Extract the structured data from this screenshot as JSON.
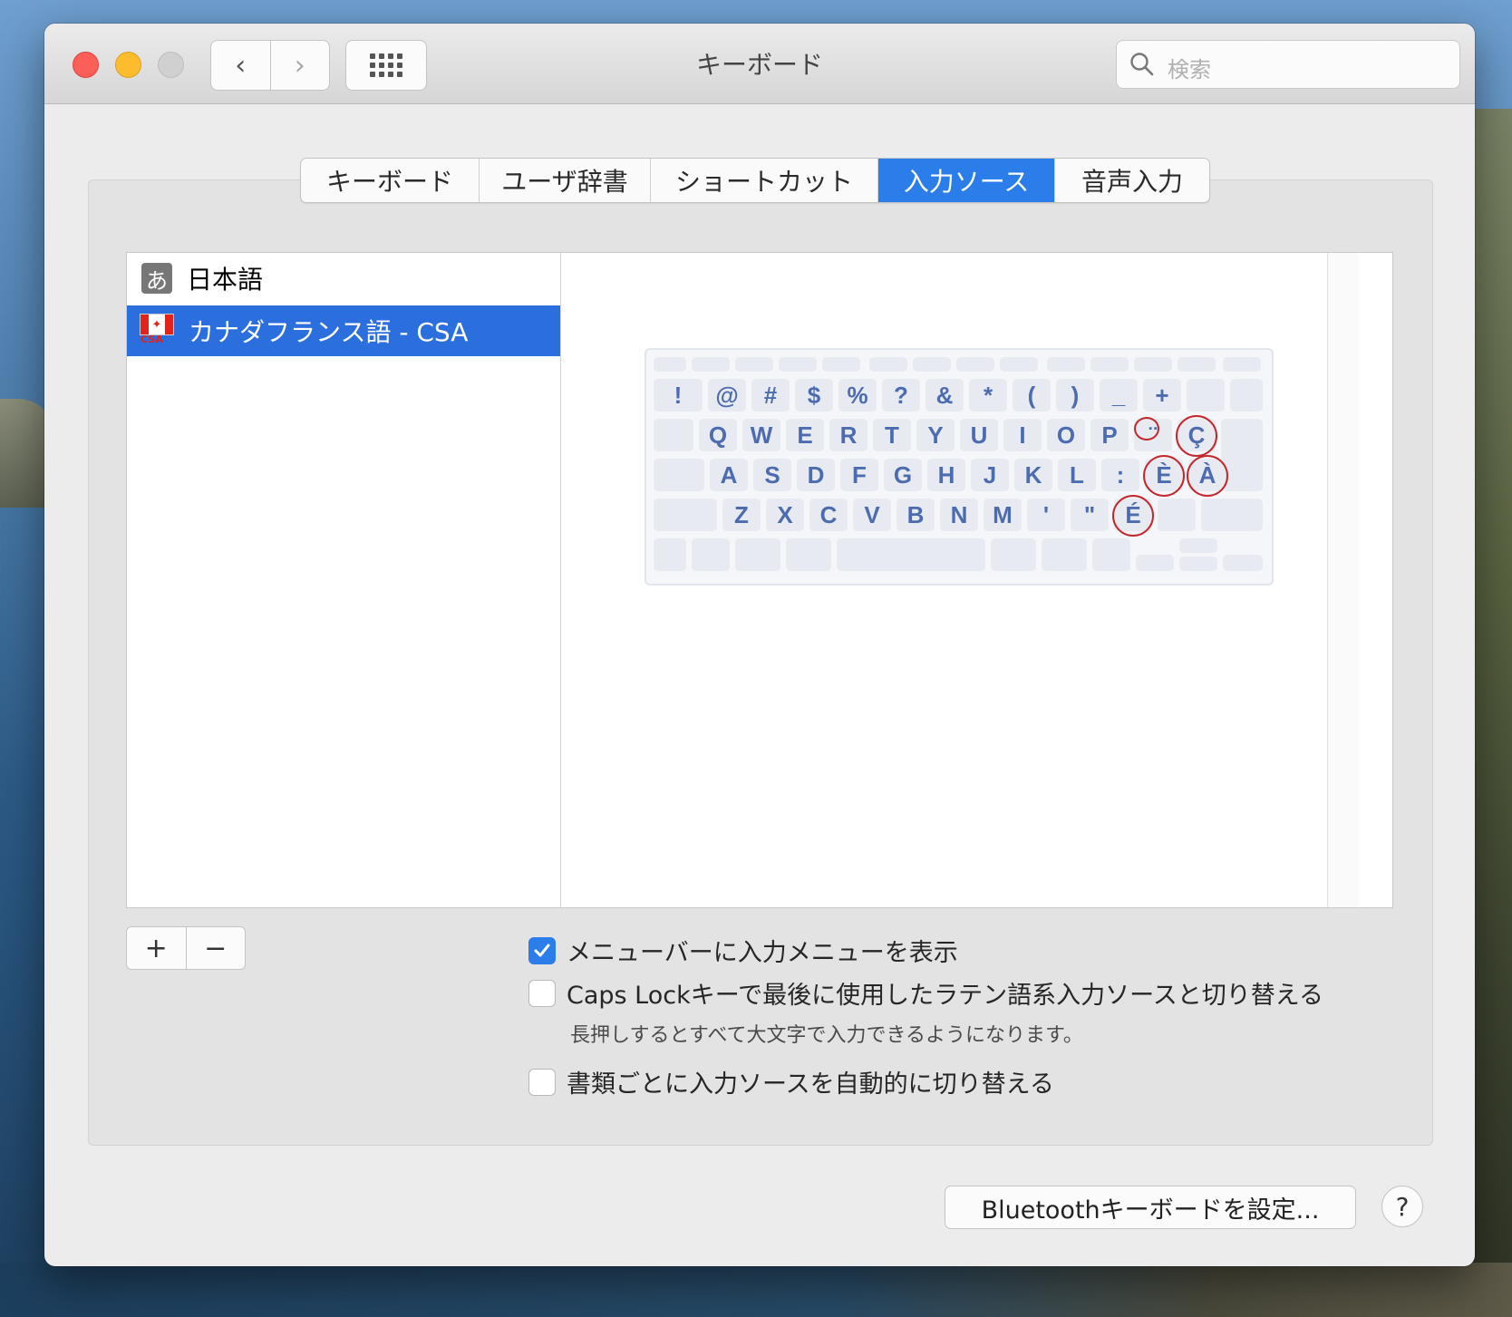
{
  "window": {
    "title": "キーボード"
  },
  "toolbar": {
    "back_glyph": "‹",
    "forward_glyph": "›",
    "search_placeholder": "検索"
  },
  "tabs": [
    {
      "label": "キーボード",
      "active": false
    },
    {
      "label": "ユーザ辞書",
      "active": false
    },
    {
      "label": "ショートカット",
      "active": false
    },
    {
      "label": "入力ソース",
      "active": true
    },
    {
      "label": "音声入力",
      "active": false
    }
  ],
  "input_sources": [
    {
      "label": "日本語",
      "icon": "japanese-kana-icon",
      "icon_text": "あ",
      "selected": false
    },
    {
      "label": "カナダフランス語 - CSA",
      "icon": "canada-flag-icon",
      "icon_text": "CSA",
      "selected": true
    }
  ],
  "keyboard_layout": {
    "row1": [
      "!",
      "@",
      "#",
      "$",
      "%",
      "?",
      "&",
      "*",
      "(",
      ")",
      "_",
      "+"
    ],
    "row2": [
      "Q",
      "W",
      "E",
      "R",
      "T",
      "Y",
      "U",
      "I",
      "O",
      "P",
      "¨",
      "Ç"
    ],
    "row3": [
      "A",
      "S",
      "D",
      "F",
      "G",
      "H",
      "J",
      "K",
      "L",
      ":",
      "È",
      "À"
    ],
    "row4": [
      "Z",
      "X",
      "C",
      "V",
      "B",
      "N",
      "M",
      "'",
      "\"",
      "É"
    ],
    "highlighted_keys": [
      "¨",
      "Ç",
      "È",
      "À",
      "É"
    ]
  },
  "list_buttons": {
    "add": "+",
    "remove": "−"
  },
  "options": [
    {
      "label": "メニューバーに入力メニューを表示",
      "checked": true
    },
    {
      "label": "Caps Lockキーで最後に使用したラテン語系入力ソースと切り替える",
      "checked": false
    },
    {
      "label": "書類ごとに入力ソースを自動的に切り替える",
      "checked": false
    }
  ],
  "caps_lock_note": "長押しするとすべて大文字で入力できるようになります。",
  "bluetooth_button": "Bluetoothキーボードを設定...",
  "help_button": "?",
  "colors": {
    "accent": "#2b7de9",
    "selection": "#2b6ede",
    "highlight_circle": "#c3272b",
    "key_text": "#4d6cb0"
  }
}
